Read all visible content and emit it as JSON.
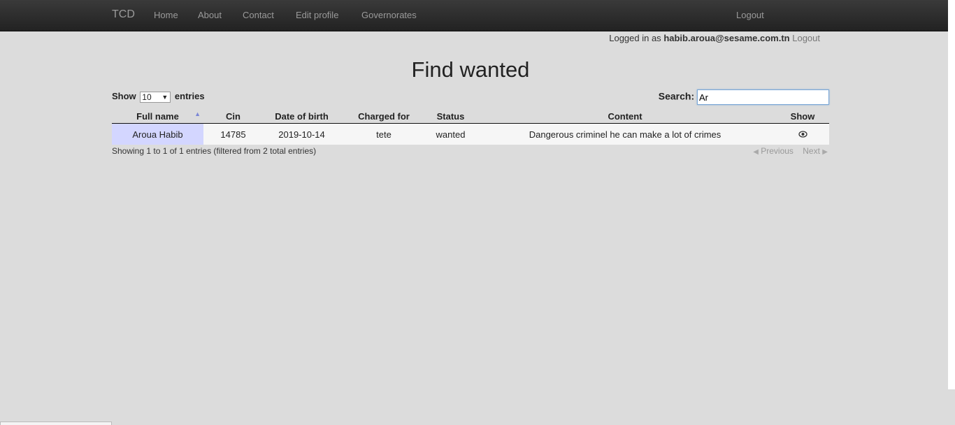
{
  "navbar": {
    "brand": "TCD",
    "items": [
      "Home",
      "About",
      "Contact",
      "Edit profile",
      "Governorates"
    ],
    "logout": "Logout"
  },
  "user_bar": {
    "prefix": "Logged in as",
    "email": "habib.aroua@sesame.com.tn",
    "logout": "Logout"
  },
  "page_title": "Find wanted",
  "length": {
    "show_label": "Show",
    "value": "10",
    "entries_label": "entries"
  },
  "search": {
    "label": "Search:",
    "value": "Ar"
  },
  "table": {
    "columns": [
      "Full name",
      "Cin",
      "Date of birth",
      "Charged for",
      "Status",
      "Content",
      "Show"
    ],
    "rows": [
      {
        "full_name": "Aroua Habib",
        "cin": "14785",
        "dob": "2019-10-14",
        "charged_for": "tete",
        "status": "wanted",
        "content": "Dangerous criminel he can make a lot of crimes",
        "show_icon": "eye-icon"
      }
    ]
  },
  "info": "Showing 1 to 1 of 1 entries (filtered from 2 total entries)",
  "pagination": {
    "previous": "Previous",
    "next": "Next"
  }
}
